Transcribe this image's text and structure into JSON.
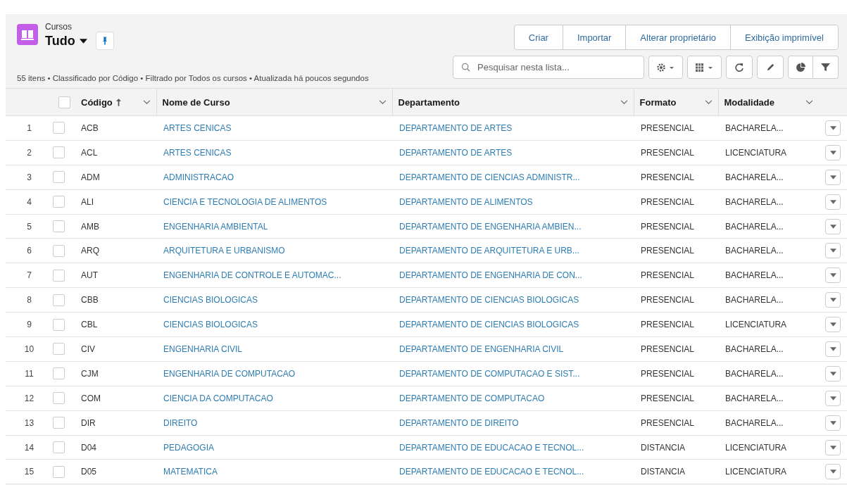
{
  "header": {
    "object": "Cursos",
    "view": "Tudo"
  },
  "status": "55 itens • Classificado por Código • Filtrado por Todos os cursos • Atualizada há poucos segundos",
  "actions": [
    "Criar",
    "Importar",
    "Alterar proprietário",
    "Exibição imprimível"
  ],
  "search": {
    "placeholder": "Pesquisar nesta lista..."
  },
  "table": {
    "all_checked": false,
    "columns": [
      {
        "label": "Código",
        "sorted": true
      },
      {
        "label": "Nome de Curso",
        "sorted": false
      },
      {
        "label": "Departamento",
        "sorted": false
      },
      {
        "label": "Formato",
        "sorted": false
      },
      {
        "label": "Modalidade",
        "sorted": false
      }
    ],
    "rows": [
      {
        "n": "1",
        "selected": false,
        "code": "ACB",
        "name": "ARTES CENICAS",
        "dept": "DEPARTAMENTO DE ARTES",
        "format": "PRESENCIAL",
        "mode": "BACHARELA..."
      },
      {
        "n": "2",
        "selected": false,
        "code": "ACL",
        "name": "ARTES CENICAS",
        "dept": "DEPARTAMENTO DE ARTES",
        "format": "PRESENCIAL",
        "mode": "LICENCIATURA"
      },
      {
        "n": "3",
        "selected": false,
        "code": "ADM",
        "name": "ADMINISTRACAO",
        "dept": "DEPARTAMENTO DE CIENCIAS ADMINISTR...",
        "format": "PRESENCIAL",
        "mode": "BACHARELA..."
      },
      {
        "n": "4",
        "selected": false,
        "code": "ALI",
        "name": "CIENCIA E TECNOLOGIA DE ALIMENTOS",
        "dept": "DEPARTAMENTO DE ALIMENTOS",
        "format": "PRESENCIAL",
        "mode": "BACHARELA..."
      },
      {
        "n": "5",
        "selected": false,
        "code": "AMB",
        "name": "ENGENHARIA AMBIENTAL",
        "dept": "DEPARTAMENTO DE ENGENHARIA AMBIEN...",
        "format": "PRESENCIAL",
        "mode": "BACHARELA..."
      },
      {
        "n": "6",
        "selected": false,
        "code": "ARQ",
        "name": "ARQUITETURA E URBANISMO",
        "dept": "DEPARTAMENTO DE ARQUITETURA E URB...",
        "format": "PRESENCIAL",
        "mode": "BACHARELA..."
      },
      {
        "n": "7",
        "selected": false,
        "code": "AUT",
        "name": "ENGENHARIA DE CONTROLE E AUTOMAC...",
        "dept": "DEPARTAMENTO DE ENGENHARIA DE CON...",
        "format": "PRESENCIAL",
        "mode": "BACHARELA..."
      },
      {
        "n": "8",
        "selected": false,
        "code": "CBB",
        "name": "CIENCIAS BIOLOGICAS",
        "dept": "DEPARTAMENTO DE CIENCIAS BIOLOGICAS",
        "format": "PRESENCIAL",
        "mode": "BACHARELA..."
      },
      {
        "n": "9",
        "selected": false,
        "code": "CBL",
        "name": "CIENCIAS BIOLOGICAS",
        "dept": "DEPARTAMENTO DE CIENCIAS BIOLOGICAS",
        "format": "PRESENCIAL",
        "mode": "LICENCIATURA"
      },
      {
        "n": "10",
        "selected": false,
        "code": "CIV",
        "name": "ENGENHARIA CIVIL",
        "dept": "DEPARTAMENTO DE ENGENHARIA CIVIL",
        "format": "PRESENCIAL",
        "mode": "BACHARELA..."
      },
      {
        "n": "11",
        "selected": false,
        "code": "CJM",
        "name": "ENGENHARIA DE COMPUTACAO",
        "dept": "DEPARTAMENTO DE COMPUTACAO E SIST...",
        "format": "PRESENCIAL",
        "mode": "BACHARELA..."
      },
      {
        "n": "12",
        "selected": false,
        "code": "COM",
        "name": "CIENCIA DA COMPUTACAO",
        "dept": "DEPARTAMENTO DE COMPUTACAO",
        "format": "PRESENCIAL",
        "mode": "BACHARELA..."
      },
      {
        "n": "13",
        "selected": false,
        "code": "DIR",
        "name": "DIREITO",
        "dept": "DEPARTAMENTO DE DIREITO",
        "format": "PRESENCIAL",
        "mode": "BACHARELA..."
      },
      {
        "n": "14",
        "selected": false,
        "code": "D04",
        "name": "PEDAGOGIA",
        "dept": "DEPARTAMENTO DE EDUCACAO E TECNOL...",
        "format": "DISTANCIA",
        "mode": "LICENCIATURA"
      },
      {
        "n": "15",
        "selected": false,
        "code": "D05",
        "name": "MATEMATICA",
        "dept": "DEPARTAMENTO DE EDUCACAO E TECNOL...",
        "format": "DISTANCIA",
        "mode": "LICENCIATURA"
      }
    ]
  }
}
